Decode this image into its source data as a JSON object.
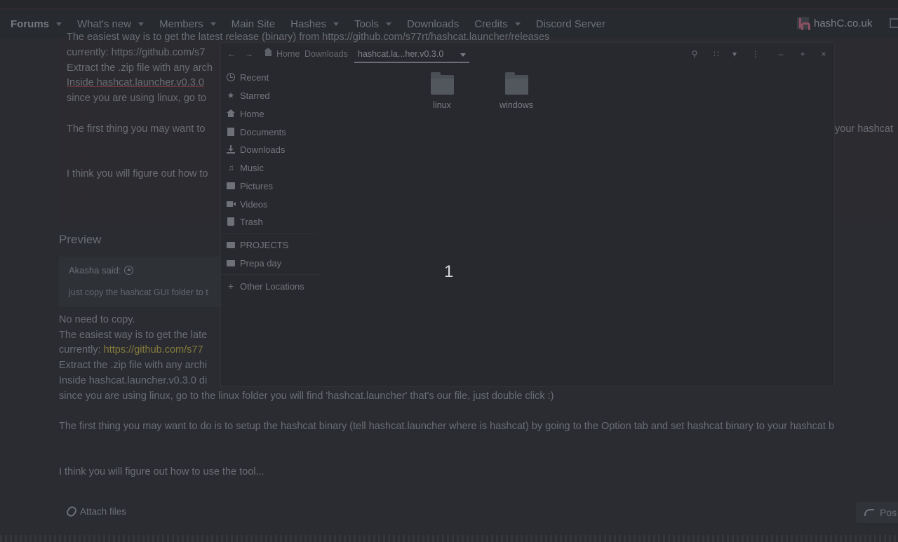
{
  "nav": {
    "items": [
      {
        "label": "Forums",
        "caret": true
      },
      {
        "label": "What's new",
        "caret": true
      },
      {
        "label": "Members",
        "caret": true
      },
      {
        "label": "Main Site",
        "caret": false
      },
      {
        "label": "Hashes",
        "caret": true
      },
      {
        "label": "Tools",
        "caret": true
      },
      {
        "label": "Downloads",
        "caret": false
      },
      {
        "label": "Credits",
        "caret": true
      },
      {
        "label": "Discord Server",
        "caret": false
      }
    ],
    "brand": "hashC.co.uk"
  },
  "editor": {
    "line0": "The easiest way is to get the latest release (binary) from https://github.com/s77rt/hashcat.launcher/releases",
    "line1": "currently: https://github.com/s7",
    "line2": "Extract the .zip file with any arch",
    "line3": "Inside hashcat.launcher.v0.3.0",
    "line4": "since you are using linux, go to",
    "line5": "The first thing you may want to",
    "line5_right": "your hashcat",
    "line6": "I think you will figure out how to"
  },
  "preview": {
    "title": "Preview",
    "quote_author": "Akasha said:",
    "quote_text": "just copy the hashcat GUI folder to t",
    "lines": [
      "No need to copy.",
      "The easiest way is to get the late",
      "currently: ",
      "Extract the .zip file with any archi",
      "Inside hashcat.launcher.v0.3.0 di",
      "since you are using linux, go to the linux folder you will find 'hashcat.launcher' that's our file, just double click :)",
      "The first thing you may want to do is to setup the hashcat binary (tell hashcat.launcher where is hashcat) by going to the Option tab and set hashcat binary to your hashcat b",
      "I think you will figure out how to use the tool..."
    ],
    "link": "https://github.com/s77",
    "attach_label": "Attach files",
    "post_label": "Pos"
  },
  "dialog": {
    "path": {
      "home": "Home",
      "downloads": "Downloads",
      "current": "hashcat.la...her.v0.3.0"
    },
    "sidebar": {
      "items": [
        {
          "label": "Recent",
          "icon": "clock-icon"
        },
        {
          "label": "Starred",
          "icon": "star-icon"
        },
        {
          "label": "Home",
          "icon": "home-icon"
        },
        {
          "label": "Documents",
          "icon": "document-icon"
        },
        {
          "label": "Downloads",
          "icon": "download-icon"
        },
        {
          "label": "Music",
          "icon": "music-icon"
        },
        {
          "label": "Pictures",
          "icon": "picture-icon"
        },
        {
          "label": "Videos",
          "icon": "video-icon"
        },
        {
          "label": "Trash",
          "icon": "trash-icon"
        }
      ],
      "bookmarks": [
        {
          "label": "PROJECTS",
          "icon": "folder-icon"
        },
        {
          "label": "Prepa day",
          "icon": "folder-icon"
        }
      ],
      "other": {
        "label": "Other Locations",
        "icon": "plus-icon"
      }
    },
    "files": [
      {
        "name": "linux"
      },
      {
        "name": "windows"
      }
    ]
  },
  "overlay_number": "1"
}
